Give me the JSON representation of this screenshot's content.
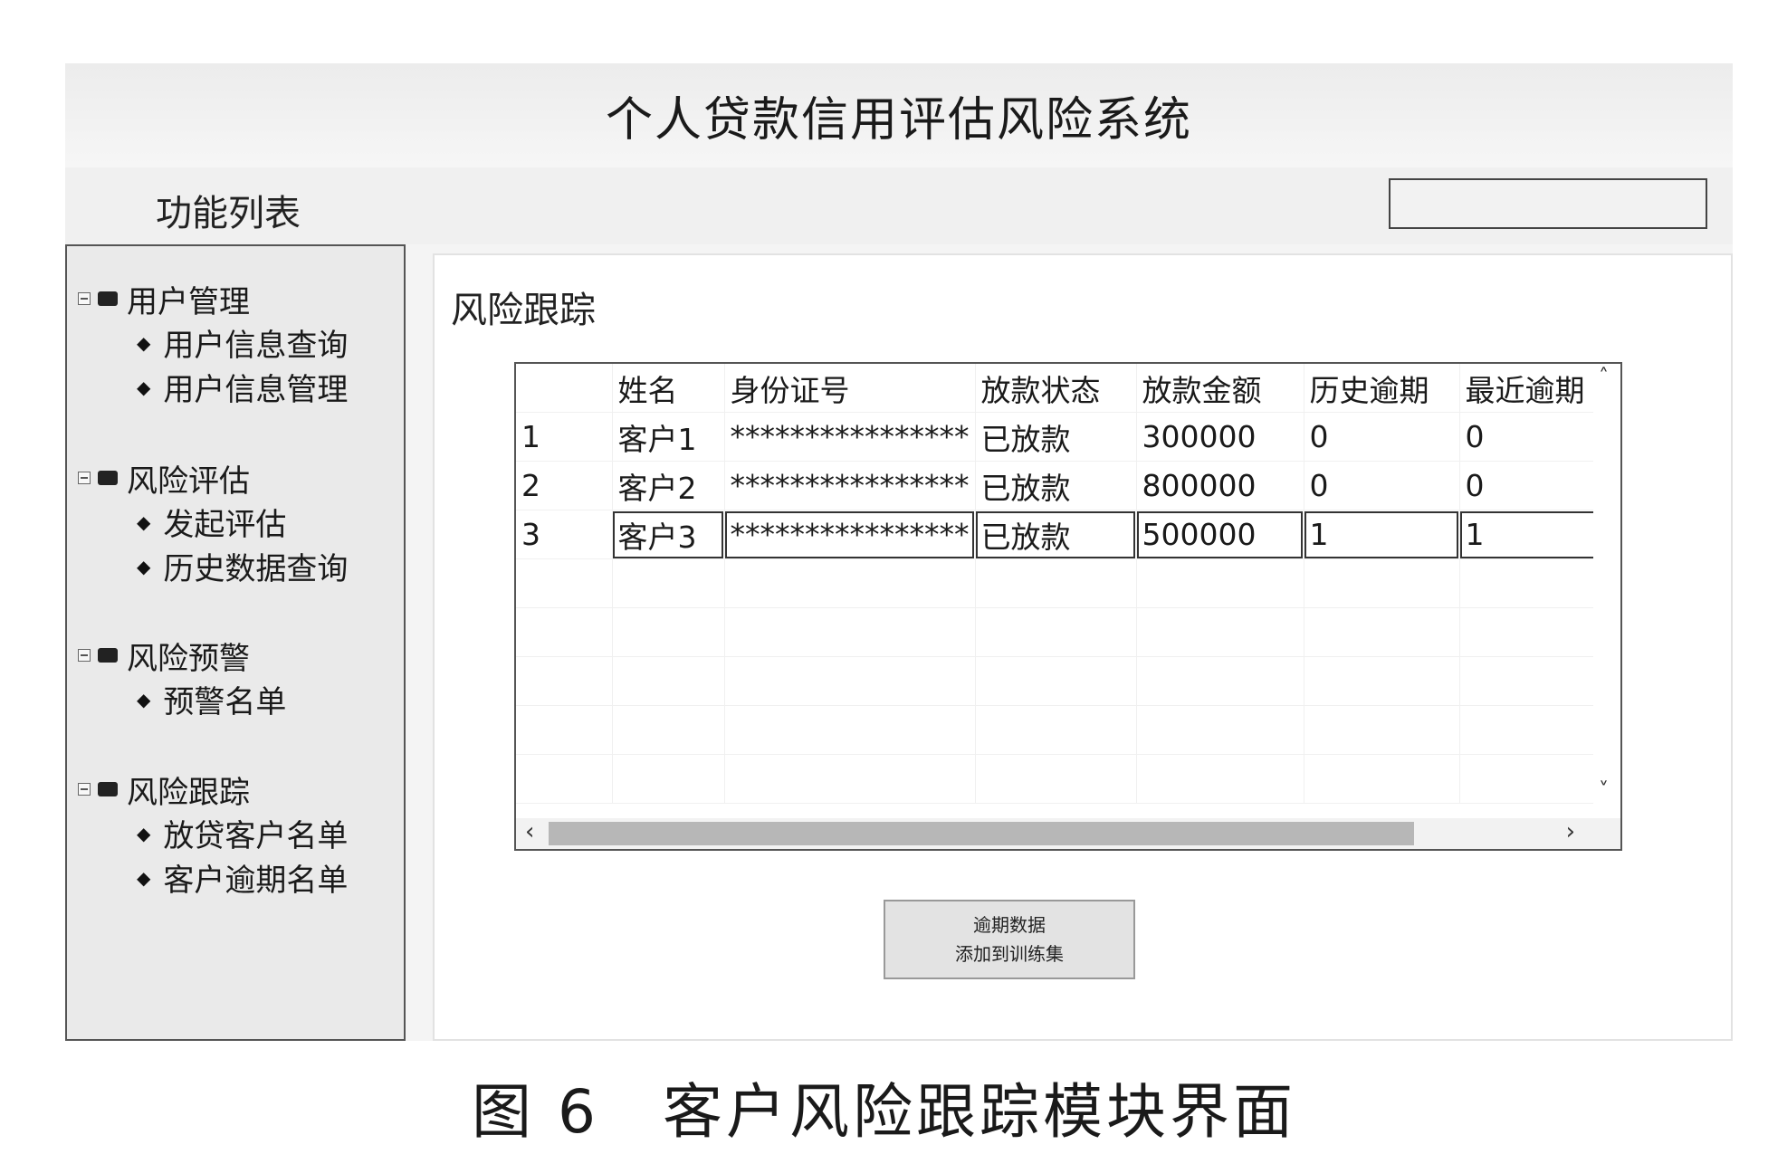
{
  "window_title": "个人贷款信用评估风险系统",
  "function_list_label": "功能列表",
  "sidebar": {
    "groups": [
      {
        "label": "用户管理",
        "items": [
          "用户信息查询",
          "用户信息管理"
        ]
      },
      {
        "label": "风险评估",
        "items": [
          "发起评估",
          "历史数据查询"
        ]
      },
      {
        "label": "风险预警",
        "items": [
          "预警名单"
        ]
      },
      {
        "label": "风险跟踪",
        "items": [
          "放贷客户名单",
          "客户逾期名单"
        ]
      }
    ]
  },
  "main": {
    "section_title": "风险跟踪",
    "table": {
      "headers": [
        "",
        "姓名",
        "身份证号",
        "放款状态",
        "放款金额",
        "历史逾期",
        "最近逾期"
      ],
      "rows": [
        [
          "1",
          "客户1",
          "****************",
          "已放款",
          "300000",
          "0",
          "0"
        ],
        [
          "2",
          "客户2",
          "****************",
          "已放款",
          "800000",
          "0",
          "0"
        ],
        [
          "3",
          "客户3",
          "****************",
          "已放款",
          "500000",
          "1",
          "1"
        ]
      ]
    },
    "button": {
      "line1": "逾期数据",
      "line2": "添加到训练集"
    }
  },
  "caption": "图 6　客户风险跟踪模块界面"
}
